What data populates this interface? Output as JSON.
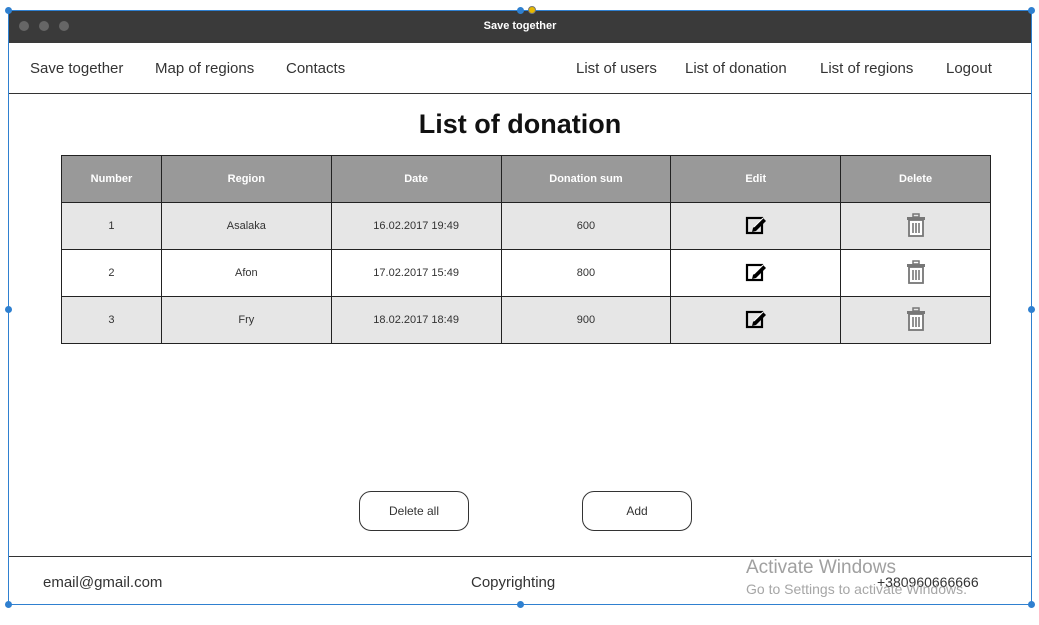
{
  "window": {
    "title": "Save together"
  },
  "nav": {
    "left": [
      "Save together",
      "Map of regions",
      "Contacts"
    ],
    "right": [
      "List of users",
      "List of donation",
      "List of regions",
      "Logout"
    ]
  },
  "page": {
    "title": "List of donation"
  },
  "table": {
    "headers": [
      "Number",
      "Region",
      "Date",
      "Donation sum",
      "Edit",
      "Delete"
    ],
    "rows": [
      {
        "number": "1",
        "region": "Asalaka",
        "date": "16.02.2017 19:49",
        "sum": "600"
      },
      {
        "number": "2",
        "region": "Afon",
        "date": "17.02.2017 15:49",
        "sum": "800"
      },
      {
        "number": "3",
        "region": "Fry",
        "date": "18.02.2017 18:49",
        "sum": "900"
      }
    ],
    "icons": {
      "edit": "edit-icon",
      "delete": "trash-icon"
    }
  },
  "actions": {
    "delete_all": "Delete all",
    "add": "Add"
  },
  "footer": {
    "email": "email@gmail.com",
    "copyright": "Copyrighting",
    "phone": "+380960666666"
  },
  "os_watermark": {
    "line1": "Activate Windows",
    "line2": "Go to Settings to activate Windows."
  },
  "colors": {
    "titlebar": "#3a3a3a",
    "header_bg": "#999999",
    "row_alt": "#e6e6e6",
    "selection": "#2f80d0"
  }
}
